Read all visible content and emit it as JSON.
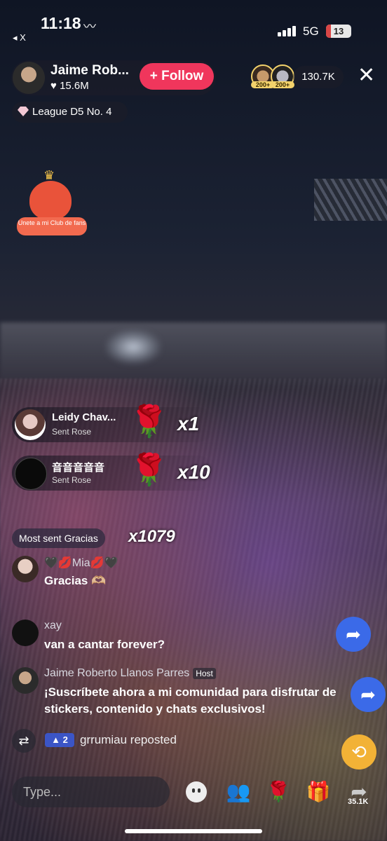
{
  "status_bar": {
    "time": "11:18",
    "back_label": "◂ X",
    "network": "5G",
    "battery": "13"
  },
  "host": {
    "name": "Jaime Rob...",
    "likes": "15.6M",
    "follow_label": "Follow",
    "viewer_badge_1": "200+",
    "viewer_badge_2": "200+",
    "viewer_count": "130.7K",
    "league": "League D5 No. 4"
  },
  "fan_club": {
    "label": "Unete a mi Club de fans"
  },
  "gifts": [
    {
      "user": "Leidy Chav...",
      "action": "Sent Rose",
      "count": "x1"
    },
    {
      "user": "音音音音音",
      "action": "Sent Rose",
      "count": "x10"
    }
  ],
  "most_sent": {
    "label": "Most sent Gracias",
    "count": "x1079"
  },
  "messages": [
    {
      "user": "🖤💋Mia💋🖤",
      "text": "Gracias 🫶🏼"
    },
    {
      "user": "xay",
      "text": "van a cantar forever?"
    },
    {
      "user": "Jaime Roberto Llanos Parres",
      "tag": "Host",
      "text": "¡Suscríbete ahora a mi comunidad para disfrutar de stickers, contenido y chats exclusivos!"
    }
  ],
  "repost": {
    "badge": "2",
    "text": "grrumiau reposted"
  },
  "bottom_bar": {
    "input_placeholder": "Type...",
    "share_count": "35.1K"
  },
  "colors": {
    "follow": "#f0365c",
    "share_fab": "#3b6ae8",
    "repost_badge": "#3b55c6"
  }
}
